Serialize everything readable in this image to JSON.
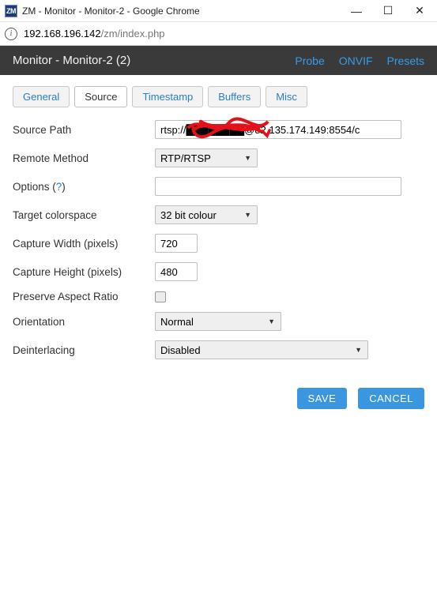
{
  "window": {
    "favicon_text": "ZM",
    "title": "ZM - Monitor - Monitor-2 - Google Chrome"
  },
  "address": {
    "host": "192.168.196.142",
    "path": "/zm/index.php"
  },
  "header": {
    "title": "Monitor - Monitor-2 (2)",
    "links": {
      "probe": "Probe",
      "onvif": "ONVIF",
      "presets": "Presets"
    }
  },
  "tabs": {
    "general": "General",
    "source": "Source",
    "timestamp": "Timestamp",
    "buffers": "Buffers",
    "misc": "Misc"
  },
  "form": {
    "source_path": {
      "label": "Source Path",
      "value": "rtsp://████████@82.135.174.149:8554/c"
    },
    "remote_method": {
      "label": "Remote Method",
      "value": "RTP/RTSP"
    },
    "options": {
      "label": "Options (",
      "help": "?",
      "label_close": ")",
      "value": ""
    },
    "target_colorspace": {
      "label": "Target colorspace",
      "value": "32 bit colour"
    },
    "capture_width": {
      "label": "Capture Width (pixels)",
      "value": "720"
    },
    "capture_height": {
      "label": "Capture Height (pixels)",
      "value": "480"
    },
    "preserve_ar": {
      "label": "Preserve Aspect Ratio",
      "checked": false
    },
    "orientation": {
      "label": "Orientation",
      "value": "Normal"
    },
    "deinterlacing": {
      "label": "Deinterlacing",
      "value": "Disabled"
    }
  },
  "actions": {
    "save": "SAVE",
    "cancel": "CANCEL"
  }
}
